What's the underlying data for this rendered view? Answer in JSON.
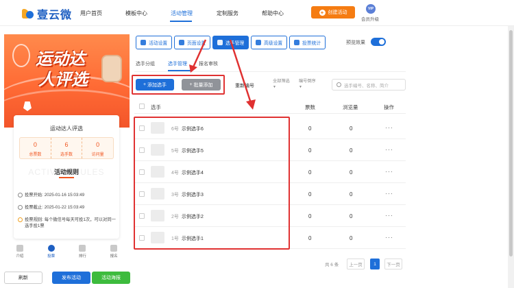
{
  "header": {
    "logo_text": "壹云微",
    "nav": [
      "用户首页",
      "模板中心",
      "活动管理",
      "定制服务",
      "帮助中心"
    ],
    "create_label": "创建活动",
    "vip_badge": "VIP",
    "vip_label": "会员升级",
    "brand_color": "#1e6fd9",
    "accent_color": "#f57c12"
  },
  "preview": {
    "poster_title_1": "运动达",
    "poster_title_2": "人评选",
    "card_title": "运动达人评选",
    "stats": [
      {
        "value": "0",
        "label": "总票数"
      },
      {
        "value": "6",
        "label": "选手数"
      },
      {
        "value": "0",
        "label": "访问量"
      }
    ],
    "rules_bg": "ACTIVITY RULES",
    "rules_title": "活动规则",
    "rules": [
      {
        "icon": "clock-icon",
        "label": "投票开始:",
        "text": "2025-01-16 15:03:49"
      },
      {
        "icon": "clock-icon",
        "label": "投票截止:",
        "text": "2025-01-22 15:03:49"
      },
      {
        "icon": "info-icon",
        "label": "投票规则:",
        "text": "每个微信号每天可投1次，可以对同一选手投1票"
      }
    ],
    "tabbar": [
      {
        "icon": "doc-icon",
        "label": "介绍"
      },
      {
        "icon": "user-icon",
        "label": "投票"
      },
      {
        "icon": "chart-icon",
        "label": "排行"
      },
      {
        "icon": "signup-icon",
        "label": "报名"
      }
    ]
  },
  "footer": {
    "refresh": "刷新",
    "publish": "发布活动",
    "poster": "活动海报"
  },
  "toolbar": {
    "buttons": [
      "活动设置",
      "页面设置",
      "选手管理",
      "高级设置",
      "投票统计"
    ],
    "preview_label": "预览效果",
    "preview_on": true
  },
  "subtabs": [
    "选手分组",
    "选手管理",
    "报名审核"
  ],
  "actions": {
    "add": "添加选手",
    "batch": "批量添加",
    "renumber": "重新编号",
    "filter_all": "全部筛选",
    "sort": "编号倒序",
    "search_placeholder": "选手编号、名称、简介"
  },
  "table": {
    "headers": {
      "player": "选手",
      "votes": "票数",
      "views": "浏览量",
      "ops": "操作"
    },
    "rows": [
      {
        "num": "6号",
        "name": "示例选手6",
        "votes": "0",
        "views": "0",
        "ops": "···"
      },
      {
        "num": "5号",
        "name": "示例选手5",
        "votes": "0",
        "views": "0",
        "ops": "···"
      },
      {
        "num": "4号",
        "name": "示例选手4",
        "votes": "0",
        "views": "0",
        "ops": "···"
      },
      {
        "num": "3号",
        "name": "示例选手3",
        "votes": "0",
        "views": "0",
        "ops": "···"
      },
      {
        "num": "2号",
        "name": "示例选手2",
        "votes": "0",
        "views": "0",
        "ops": "···"
      },
      {
        "num": "1号",
        "name": "示例选手1",
        "votes": "0",
        "views": "0",
        "ops": "···"
      }
    ]
  },
  "pagination": {
    "total": "共 6 条",
    "prev": "上一页",
    "page": "1",
    "next": "下一页"
  },
  "annotation_color": "#e03131"
}
